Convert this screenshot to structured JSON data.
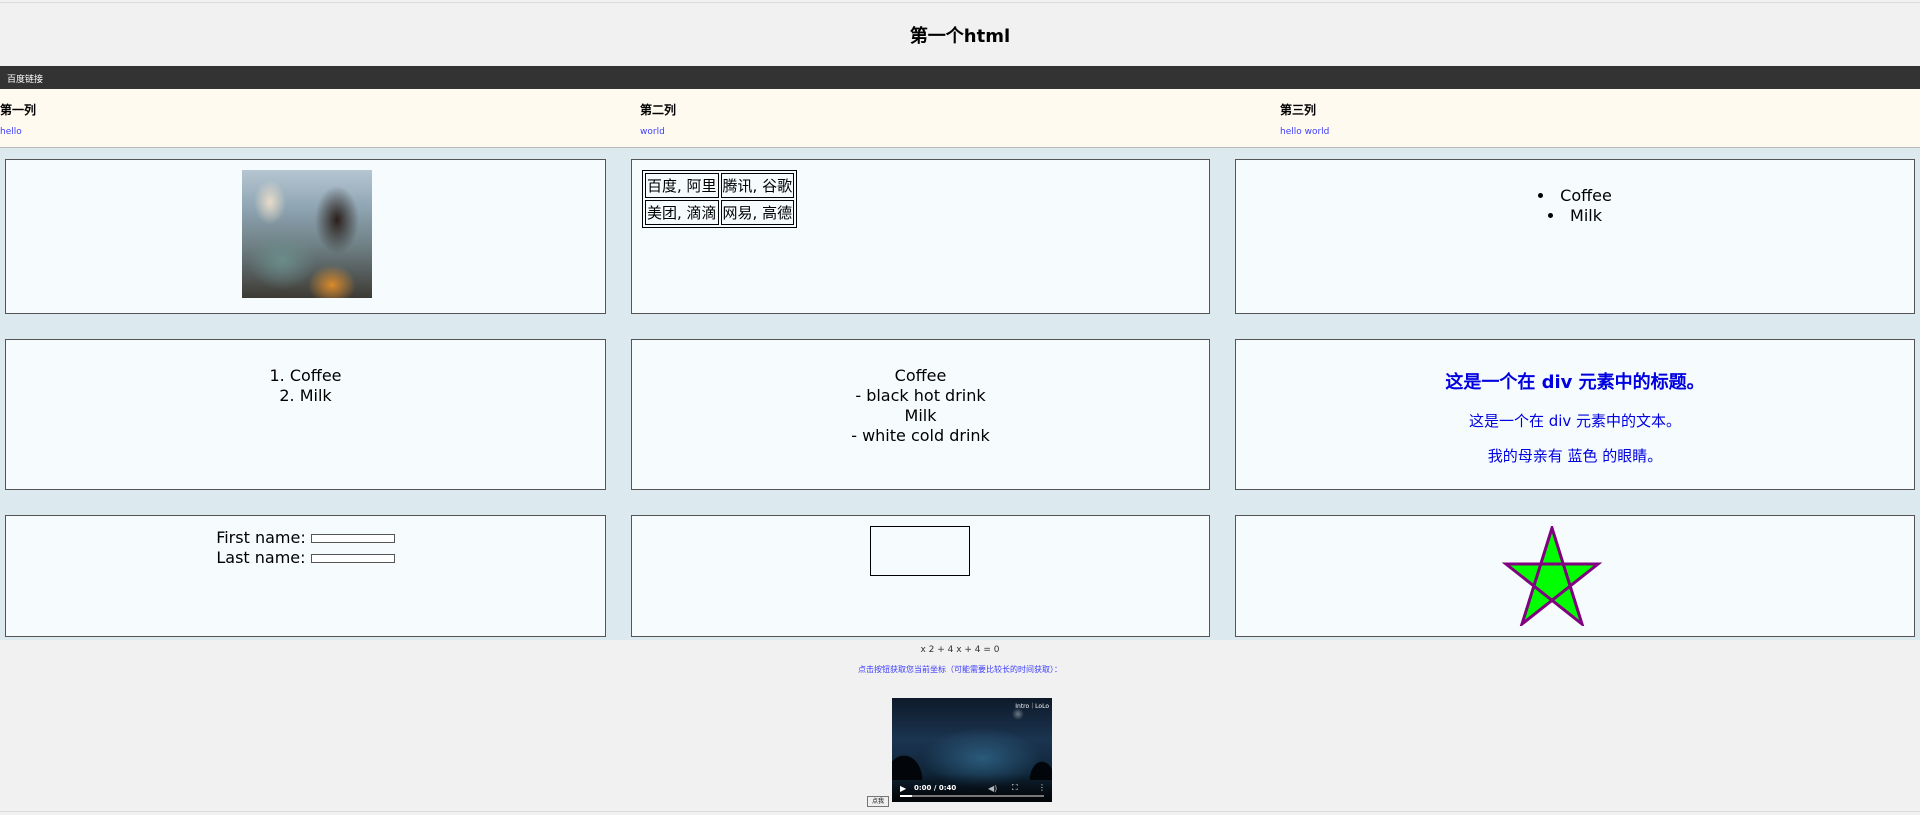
{
  "header": {
    "title": "第一个html"
  },
  "nav": {
    "link_label": "百度链接"
  },
  "columns": [
    {
      "heading": "第一列",
      "text": "hello"
    },
    {
      "heading": "第二列",
      "text": "world"
    },
    {
      "heading": "第三列",
      "text": "hello world"
    }
  ],
  "table": {
    "rows": [
      [
        "百度, 阿里",
        "腾讯, 谷歌"
      ],
      [
        "美团, 滴滴",
        "网易, 高德"
      ]
    ]
  },
  "unordered_list": [
    "Coffee",
    "Milk"
  ],
  "ordered_list": [
    "Coffee",
    "Milk"
  ],
  "definition_list": [
    {
      "term": "Coffee",
      "desc": "- black hot drink"
    },
    {
      "term": "Milk",
      "desc": "- white cold drink"
    }
  ],
  "div_block": {
    "heading": "这是一个在 div 元素中的标题。",
    "text": "这是一个在 div 元素中的文本。",
    "eyes_text": "我的母亲有 蓝色 的眼睛。",
    "color": "#0000e0"
  },
  "form": {
    "first_label": "First name:",
    "last_label": "Last name:",
    "first_value": "",
    "last_value": ""
  },
  "star": {
    "fill": "#00ff00",
    "stroke": "#800080"
  },
  "math_text": "x 2 + 4 x + 4 = 0",
  "coord_text": "点击按钮获取您当前坐标（可能需要比较长的时间获取）：",
  "video": {
    "overlay_text": "Intro｜LoLo",
    "time": "0:00 / 0:40",
    "progress": 0.08
  },
  "button": {
    "label": "点我"
  }
}
